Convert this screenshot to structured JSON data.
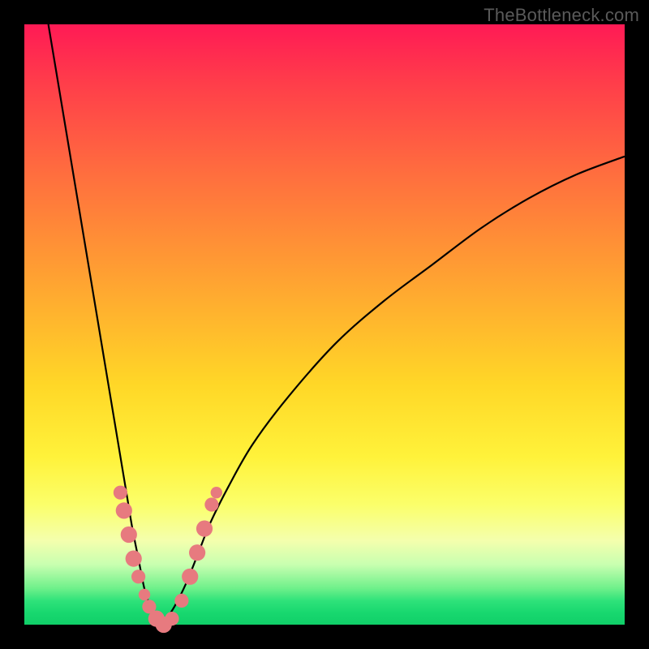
{
  "watermark": "TheBottleneck.com",
  "colors": {
    "frame": "#000000",
    "gradient_top": "#ff1a55",
    "gradient_mid": "#ffe638",
    "gradient_bottom": "#10cf68",
    "curve": "#000000",
    "marker": "#e77a7f"
  },
  "chart_data": {
    "type": "line",
    "title": "",
    "xlabel": "",
    "ylabel": "",
    "xlim": [
      0,
      100
    ],
    "ylim": [
      0,
      100
    ],
    "note": "V-shaped bottleneck curve: steep left branch descending to ~0 near x≈22, shallow right branch rising toward ~78 at x=100. Y increases upward (0 = green optimum).",
    "series": [
      {
        "name": "left_branch",
        "x": [
          4,
          6,
          8,
          10,
          12,
          14,
          15,
          16,
          17,
          18,
          19,
          20,
          21,
          22,
          23
        ],
        "y": [
          100,
          88,
          76,
          64,
          52,
          40,
          34,
          28,
          22,
          16,
          11,
          6,
          3,
          1,
          0
        ]
      },
      {
        "name": "right_branch",
        "x": [
          23,
          25,
          27,
          29,
          31,
          34,
          38,
          44,
          52,
          60,
          68,
          76,
          84,
          92,
          100
        ],
        "y": [
          0,
          3,
          7,
          12,
          17,
          23,
          30,
          38,
          47,
          54,
          60,
          66,
          71,
          75,
          78
        ]
      }
    ],
    "markers": {
      "name": "highlighted_points",
      "note": "pink dot/capsule markers clustered near the vertex on both branches, roughly y ∈ [0,22]",
      "points": [
        {
          "x": 16.0,
          "y": 22,
          "r": 1.2
        },
        {
          "x": 16.6,
          "y": 19,
          "r": 1.4
        },
        {
          "x": 17.4,
          "y": 15,
          "r": 1.4
        },
        {
          "x": 18.2,
          "y": 11,
          "r": 1.4
        },
        {
          "x": 19.0,
          "y": 8,
          "r": 1.2
        },
        {
          "x": 20.0,
          "y": 5,
          "r": 1.0
        },
        {
          "x": 20.8,
          "y": 3,
          "r": 1.2
        },
        {
          "x": 22.0,
          "y": 1,
          "r": 1.4
        },
        {
          "x": 23.2,
          "y": 0,
          "r": 1.4
        },
        {
          "x": 24.6,
          "y": 1,
          "r": 1.2
        },
        {
          "x": 26.2,
          "y": 4,
          "r": 1.2
        },
        {
          "x": 27.6,
          "y": 8,
          "r": 1.4
        },
        {
          "x": 28.8,
          "y": 12,
          "r": 1.4
        },
        {
          "x": 30.0,
          "y": 16,
          "r": 1.4
        },
        {
          "x": 31.2,
          "y": 20,
          "r": 1.2
        },
        {
          "x": 32.0,
          "y": 22,
          "r": 1.0
        }
      ]
    }
  }
}
